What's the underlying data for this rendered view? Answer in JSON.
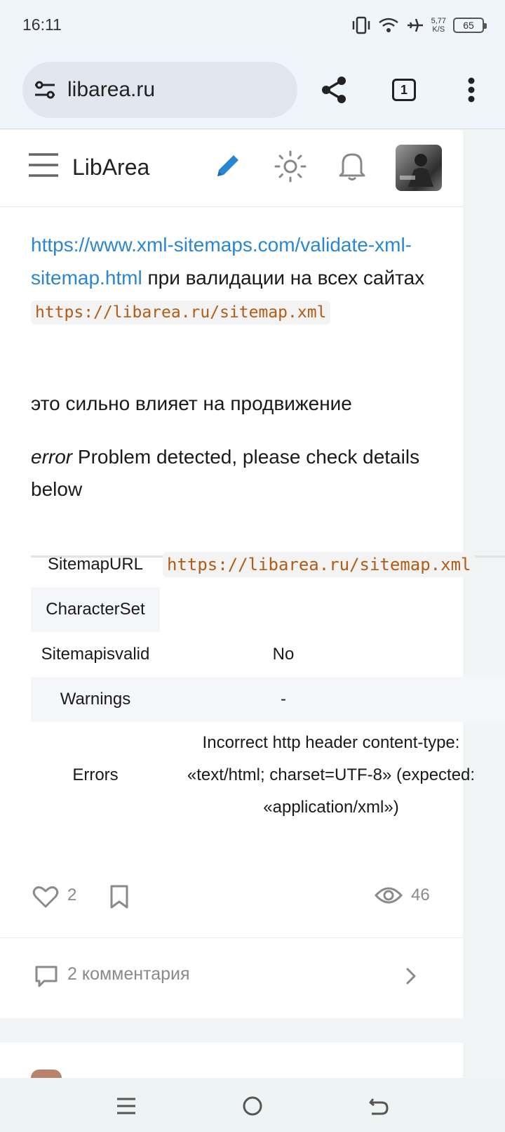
{
  "status_bar": {
    "time": "16:11",
    "speed_value": "5,77",
    "speed_unit": "K/S",
    "battery": "65"
  },
  "browser": {
    "url": "libarea.ru",
    "tab_count": "1"
  },
  "site": {
    "logo": "LibArea"
  },
  "post": {
    "link_text": "https://www.xml-sitemaps.com/validate-xml-sitemap.html",
    "text_after_link": " при валидации на всех сайтах",
    "code_url": "https://libarea.ru/sitemap.xml",
    "promo_text": "это сильно влияет на продвижение",
    "error_word": "error",
    "error_text": " Problem detected, please check details below"
  },
  "table": {
    "rows": [
      {
        "label": "SitemapURL",
        "value": "https://libarea.ru/sitemap.xml"
      },
      {
        "label": "CharacterSet",
        "value": ""
      },
      {
        "label": "Sitemapisvalid",
        "value": "No"
      },
      {
        "label": "Warnings",
        "value": "-"
      },
      {
        "label": "Errors",
        "value": "Incorrect http header content-type: «text/html; charset=UTF-8» (expected: «application/xml»)"
      }
    ]
  },
  "actions": {
    "likes": "2",
    "views": "46"
  },
  "comments": {
    "label": "2 комментария"
  },
  "icons": {
    "site_settings": "tune-icon",
    "share": "share-icon",
    "menu": "more-vert-icon",
    "hamburger": "hamburger-icon",
    "edit": "pencil-icon",
    "theme": "sun-icon",
    "notifications": "bell-icon",
    "like": "heart-icon",
    "bookmark": "bookmark-icon",
    "views": "eye-icon",
    "comment": "comment-icon",
    "chevron": "chevron-right-icon"
  },
  "colors": {
    "link": "#2a86d1",
    "code": "#b15c16",
    "accent_edit": "#2a86d1"
  }
}
